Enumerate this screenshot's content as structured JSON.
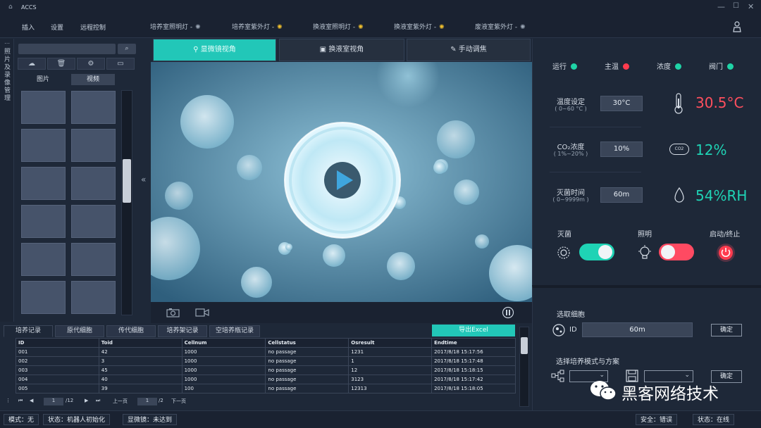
{
  "app": {
    "title": "ACCS"
  },
  "menu": {
    "insert": "插入",
    "settings": "设置",
    "remote": "远程控制"
  },
  "lamps": [
    {
      "label": "培养室照明灯 -"
    },
    {
      "label": "培养室紫外灯 -"
    },
    {
      "label": "换液室照明灯 -"
    },
    {
      "label": "换液室紫外灯 -"
    },
    {
      "label": "废液室紫外灯 -"
    }
  ],
  "sidebar": {
    "vertical_label": "照片及录像管理"
  },
  "media_tabs": {
    "photos": "图片",
    "videos": "视频"
  },
  "view_tabs": {
    "microscope": "显微镜视角",
    "exchange": "换液室视角",
    "focus": "手动调焦"
  },
  "status_indicators": [
    {
      "label": "运行",
      "color": "#1fd3a6"
    },
    {
      "label": "主温",
      "color": "#ff3b4e"
    },
    {
      "label": "浓度",
      "color": "#1fd3a6"
    },
    {
      "label": "阀门",
      "color": "#1fd3a6"
    }
  ],
  "params": {
    "temp": {
      "label": "温度设定",
      "range": "( 0~60 °C )",
      "value": "30°C",
      "reading": "30.5°C"
    },
    "co2": {
      "label": "CO₂浓度",
      "range": "( 1%~20% )",
      "value": "10%",
      "reading": "12%",
      "icon_text": "CO2"
    },
    "sterilize_time": {
      "label": "灭菌时间",
      "range": "( 0~9999m )",
      "value": "60m",
      "reading": "54%RH"
    }
  },
  "controls": {
    "sterilize": "灭菌",
    "lighting": "照明",
    "start_stop": "启动/终止"
  },
  "select_cell": {
    "title": "选取细胞",
    "id_label": "ID",
    "id_value": "60m",
    "confirm": "确定"
  },
  "mode": {
    "title": "选择培养模式与方案",
    "confirm": "确定"
  },
  "table_tabs": [
    "培养记录",
    "原代细胞",
    "传代细胞",
    "培养架记录",
    "空培养瓶记录"
  ],
  "export_label": "导出Excel",
  "table": {
    "headers": [
      "ID",
      "Toid",
      "Cellnum",
      "Cellstatus",
      "Osresult",
      "Endtime"
    ],
    "rows": [
      [
        "001",
        "42",
        "1000",
        "no passage",
        "1231",
        "2017/8/18 15:17:56"
      ],
      [
        "002",
        "3",
        "1000",
        "no passage",
        "1",
        "2017/8/18 15:17:48"
      ],
      [
        "003",
        "45",
        "1000",
        "no passage",
        "12",
        "2017/8/18 15:18:15"
      ],
      [
        "004",
        "40",
        "1000",
        "no passage",
        "3123",
        "2017/8/18 15:17:42"
      ],
      [
        "005",
        "39",
        "100",
        "no passage",
        "12313",
        "2017/8/18 15:18:05"
      ]
    ]
  },
  "pager": {
    "page_input": "1",
    "page_total": "/12",
    "prev": "上一页",
    "page_input2": "1",
    "page_total2": "/2",
    "next": "下一页"
  },
  "statusbar": {
    "mode": "模式：无",
    "state": "状态：机器人初始化",
    "microscope": "显微镜：未达到",
    "safety": "安全：错误",
    "online": "状态：在线"
  },
  "watermark": "黑客网络技术"
}
